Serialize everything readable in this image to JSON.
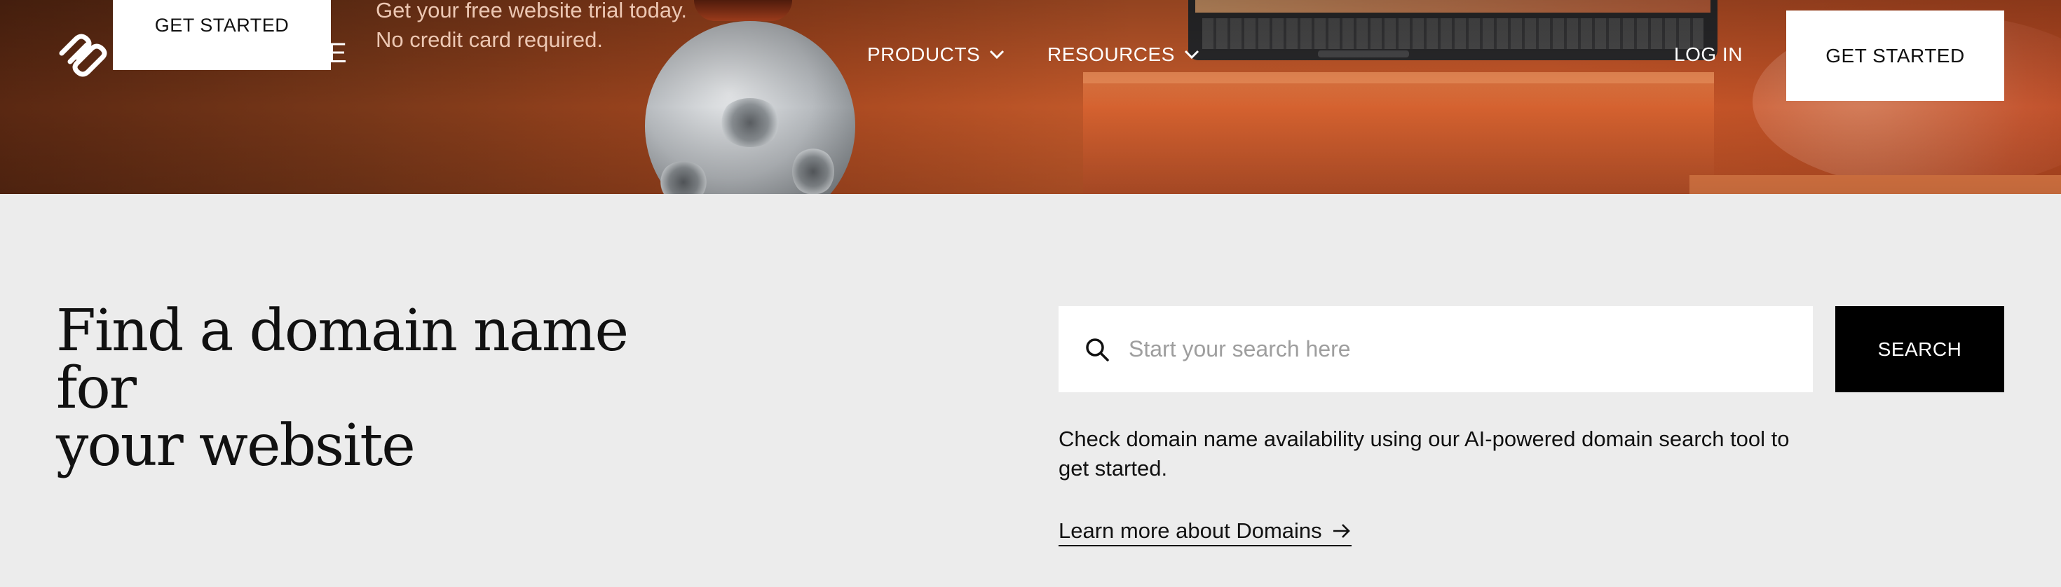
{
  "header": {
    "brand_trail": "E",
    "trial_button_label": "GET STARTED",
    "trial_text_line1": "Get your free website trial today.",
    "trial_text_line2": "No credit card required.",
    "nav": [
      {
        "label": "PRODUCTS",
        "icon": "chevron-down-icon"
      },
      {
        "label": "RESOURCES",
        "icon": "chevron-down-icon"
      }
    ],
    "login_label": "LOG IN",
    "cta_label": "GET STARTED"
  },
  "main": {
    "title_line1": "Find a domain name for",
    "title_line2": "your website",
    "search": {
      "placeholder": "Start your search here",
      "value": "",
      "icon": "search-icon",
      "button_label": "SEARCH"
    },
    "description_line1": "Check domain name availability using our AI-powered domain search tool to",
    "description_line2": "get started.",
    "learn_more_label": "Learn more about Domains",
    "learn_more_icon": "arrow-right-icon"
  },
  "colors": {
    "page_bg": "#ececec",
    "button_dark": "#000000",
    "button_light": "#ffffff",
    "text": "#111111",
    "hero_orange": "#c8582a"
  }
}
